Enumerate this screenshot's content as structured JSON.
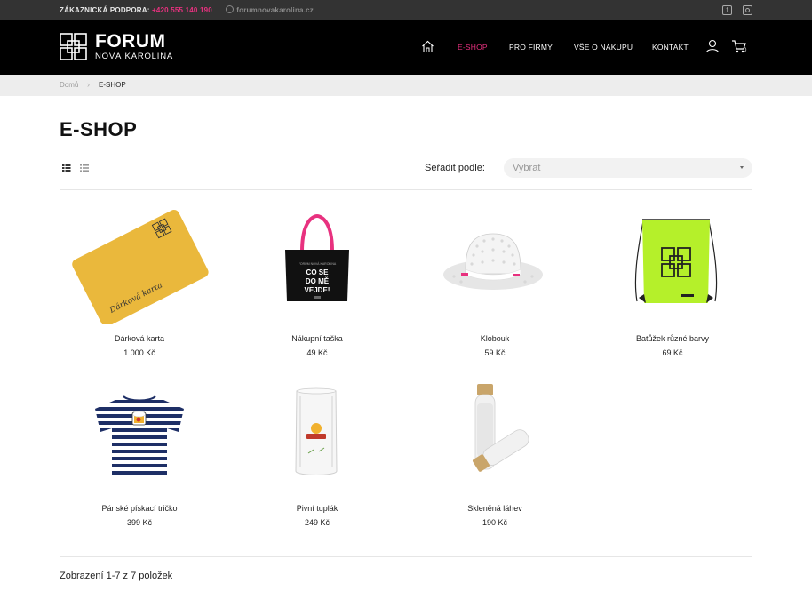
{
  "topbar": {
    "support_label": "ZÁKAZNICKÁ PODPORA:",
    "phone": "+420 555 140 190",
    "separator": "|",
    "website": "forumnovakarolina.cz",
    "social": [
      "facebook-icon",
      "instagram-icon"
    ]
  },
  "header": {
    "logo_title": "FORUM",
    "logo_subtitle": "NOVÁ KAROLINA",
    "nav": [
      {
        "label": "E-SHOP",
        "active": true
      },
      {
        "label": "PRO FIRMY"
      },
      {
        "label": "VŠE O NÁKUPU"
      },
      {
        "label": "KONTAKT"
      }
    ],
    "cart_count": "0",
    "accent_color": "#e8317f"
  },
  "breadcrumb": {
    "home": "Domů",
    "separator": "›",
    "current": "E-SHOP"
  },
  "page": {
    "title": "E-SHOP"
  },
  "toolbar": {
    "sort_label": "Seřadit podle:",
    "sort_value": "Vybrat"
  },
  "products": [
    {
      "name": "Dárková karta",
      "price": "1 000 Kč",
      "card_text": "Dárková karta"
    },
    {
      "name": "Nákupní taška",
      "price": "49 Kč",
      "bag_text": "CO SE DO MĚ VEJDE!"
    },
    {
      "name": "Klobouk",
      "price": "59 Kč"
    },
    {
      "name": "Batůžek různé barvy",
      "price": "69 Kč"
    },
    {
      "name": "Pánské pískací tričko",
      "price": "399 Kč"
    },
    {
      "name": "Pivní tuplák",
      "price": "249 Kč"
    },
    {
      "name": "Skleněná láhev",
      "price": "190 Kč"
    }
  ],
  "footer": {
    "count_text": "Zobrazení 1-7 z 7 položek"
  }
}
